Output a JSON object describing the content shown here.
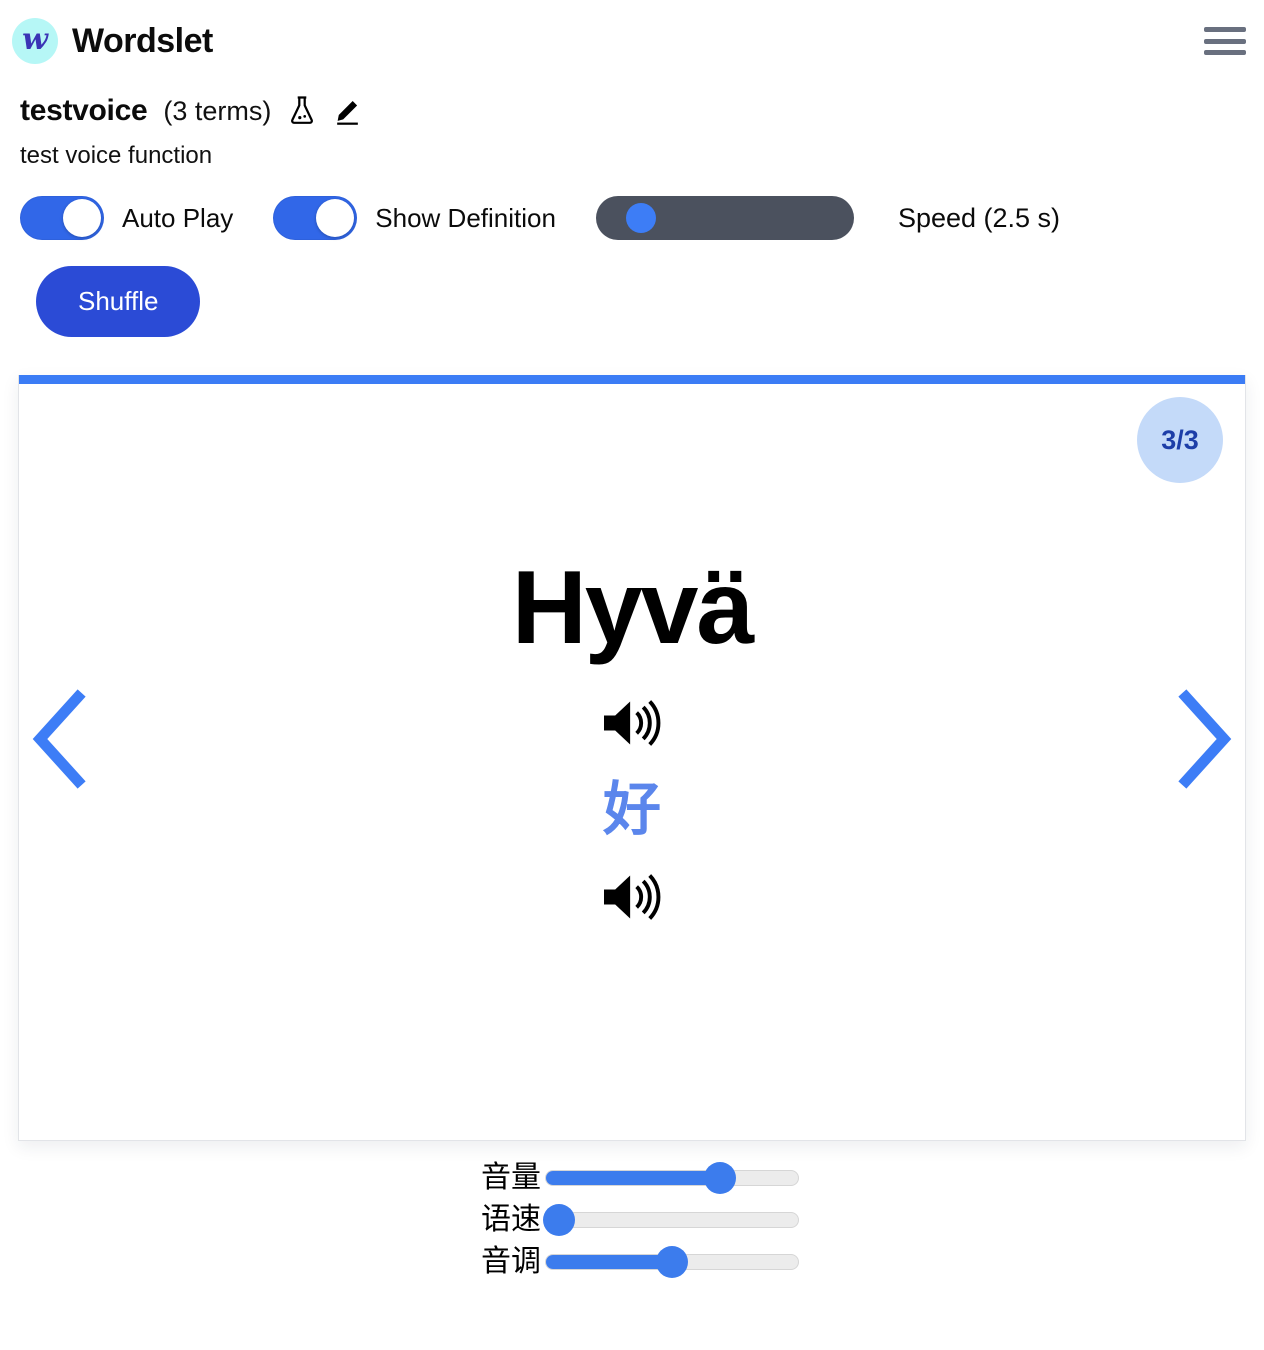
{
  "app": {
    "brand_name": "Wordslet",
    "logo_letter": "w",
    "logo_bg": "#b6f7f6",
    "logo_fg": "#3b34b5",
    "menu_icon": "hamburger-menu-icon"
  },
  "set": {
    "title": "testvoice",
    "term_count_label": "(3 terms)",
    "description": "test voice function",
    "test_icon": "flask-icon",
    "edit_icon": "pencil-icon"
  },
  "controls": {
    "auto_play": {
      "label": "Auto Play",
      "on": true
    },
    "show_definition": {
      "label": "Show Definition",
      "on": true
    },
    "speed": {
      "label": "Speed (2.5 s)",
      "value_seconds": 2.5,
      "thumb_percent": 12
    },
    "shuffle_label": "Shuffle",
    "accent_color": "#3167e8",
    "shuffle_color": "#2b4bd6"
  },
  "flashcard": {
    "progress_badge": "3/3",
    "current_index": 3,
    "total": 3,
    "term": "Hyvä",
    "definition": "好",
    "term_speaker_icon": "speaker-icon",
    "definition_speaker_icon": "speaker-icon",
    "prev_icon": "chevron-left-icon",
    "next_icon": "chevron-right-icon",
    "top_bar_color": "#3b7cf5",
    "badge_bg": "#c4daf9",
    "badge_fg": "#1d3ea8",
    "definition_color": "#5b86ec"
  },
  "voice_sliders": [
    {
      "label": "音量",
      "name": "volume",
      "percent": 69
    },
    {
      "label": "语速",
      "name": "rate",
      "percent": 5
    },
    {
      "label": "音调",
      "name": "pitch",
      "percent": 50
    }
  ]
}
